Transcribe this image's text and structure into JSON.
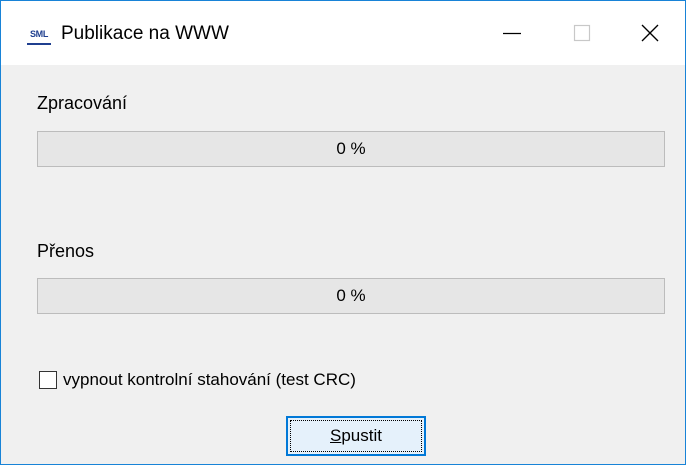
{
  "window": {
    "title": "Publikace na WWW",
    "icon": "sml-app-icon",
    "icon_text": "SML"
  },
  "processing": {
    "label": "Zpracování",
    "progress_text": "0 %",
    "progress_value": 0
  },
  "transfer": {
    "label": "Přenos",
    "progress_text": "0 %",
    "progress_value": 0
  },
  "options": {
    "crc_check_label": "vypnout kontrolní stahování (test CRC)",
    "crc_check_checked": false
  },
  "actions": {
    "start_label_accel": "S",
    "start_label_rest": "pustit"
  },
  "colors": {
    "accent": "#0078d7",
    "window_border": "#1883d7",
    "progress_fill": "#06b025"
  }
}
